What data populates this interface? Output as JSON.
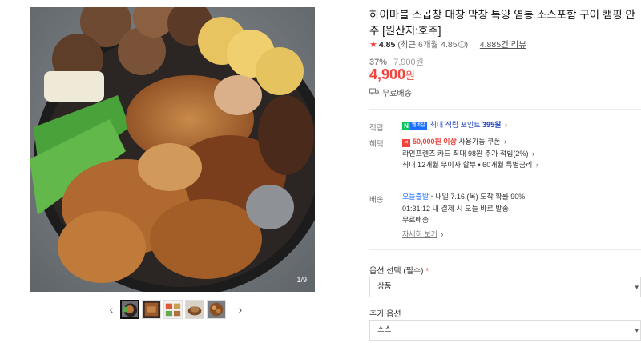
{
  "gallery": {
    "page_counter": "1/9",
    "prev_icon": "chevron-left-icon",
    "next_icon": "chevron-right-icon",
    "thumbnails": 5
  },
  "product": {
    "title": "하이마블 소곱창 대창 막창 특양 염통 소스포함 구이 캠핑 안주 [원산지:호주]",
    "rating_score": "4.85",
    "rating_recent": "(최근 6개월 4.85",
    "rating_recent_close": ")",
    "review_count": "4,885건 리뷰",
    "discount_rate": "37%",
    "original_price": "7,900원",
    "price": "4,900",
    "price_unit": "원",
    "shipping": "무료배송"
  },
  "benefits": {
    "points_label": "적립",
    "npay_mark": "N",
    "npay_sub": "멤버십",
    "points_text": "최대 적립 포인트",
    "points_value": "395원",
    "benefit_label": "혜택",
    "coupon_strong": "50,000원 이상",
    "coupon_text": "사용가능 쿠폰",
    "card_text": "라인프렌즈 카드 최대 98원 추가 적립(2%)",
    "installment_text": "최대 12개월 무이자 할부 • 60개월 특별금리"
  },
  "delivery": {
    "label": "배송",
    "today_tag": "오늘출발",
    "arrival_text": "내일 7.16.(목) 도착 확률 90%",
    "countdown": "01:31:12",
    "countdown_text": "내 결제 시 오늘 바로 발송",
    "free_text": "무료배송",
    "detail_link": "자세히 보기"
  },
  "options": {
    "select_label": "옵션 선택 (필수)",
    "required_mark": "*",
    "select_value": "상품",
    "extra_label": "추가 옵션",
    "extra_value": "소스"
  },
  "colors": {
    "accent_red": "#f0443c",
    "naver_green": "#03c75a",
    "link_blue": "#1e6eff"
  }
}
